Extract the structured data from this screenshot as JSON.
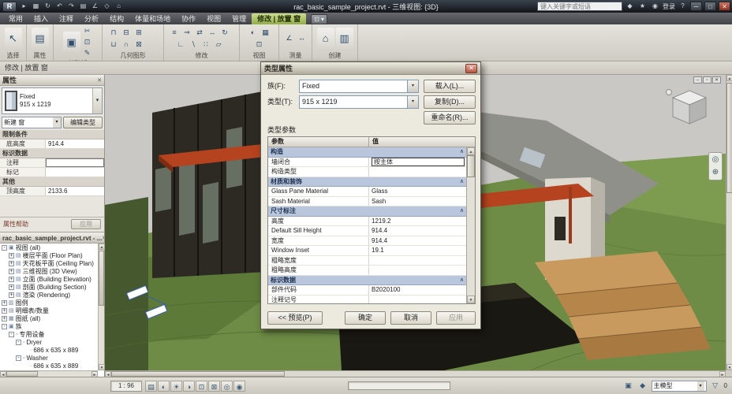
{
  "ui": {
    "caret": "▾",
    "scroll_up": "▲",
    "scroll_down": "▼",
    "scroll_left": "◄",
    "scroll_right": "►",
    "close": "✕",
    "minimize": "─",
    "maximize": "□"
  },
  "titlebar": {
    "app_button": "R",
    "qat": [
      {
        "name": "open-icon",
        "glyph": "▸"
      },
      {
        "name": "save-icon",
        "glyph": "▦"
      },
      {
        "name": "sync-icon",
        "glyph": "↻"
      },
      {
        "name": "undo-icon",
        "glyph": "↶"
      },
      {
        "name": "redo-icon",
        "glyph": "↷"
      },
      {
        "name": "print-icon",
        "glyph": "▤"
      },
      {
        "name": "measure-icon",
        "glyph": "∠"
      },
      {
        "name": "tag-icon",
        "glyph": "◇"
      },
      {
        "name": "default-3d-icon",
        "glyph": "⌂"
      }
    ],
    "title": "rac_basic_sample_project.rvt - 三维视图: {3D}",
    "search_placeholder": "键入关键字或短语",
    "right_icons": [
      {
        "name": "communication-center-icon",
        "glyph": "◆"
      },
      {
        "name": "favorites-icon",
        "glyph": "★"
      },
      {
        "name": "user-icon",
        "glyph": "◉"
      }
    ],
    "signin_label": "登录",
    "help_glyph": "?"
  },
  "tabs": [
    {
      "label": "常用"
    },
    {
      "label": "插入"
    },
    {
      "label": "注释"
    },
    {
      "label": "分析"
    },
    {
      "label": "结构"
    },
    {
      "label": "体量和场地"
    },
    {
      "label": "协作"
    },
    {
      "label": "视图"
    },
    {
      "label": "管理"
    },
    {
      "label": "修改 | 放置 窗",
      "active": true
    }
  ],
  "tab_extra": {
    "glyph": "⊡"
  },
  "ribbon": {
    "panels": [
      {
        "label": "选择",
        "tools": [
          {
            "name": "modify-select-tool",
            "glyph": "↖"
          }
        ]
      },
      {
        "label": "属性",
        "tools": [
          {
            "name": "properties-tool",
            "glyph": "▤"
          }
        ]
      },
      {
        "label": "剪贴板",
        "tools": [
          {
            "name": "paste-tool",
            "glyph": "▣"
          },
          {
            "name": "cut-tool",
            "glyph": "✂"
          },
          {
            "name": "copy-tool",
            "glyph": "⊡"
          },
          {
            "name": "match-type-tool",
            "glyph": "✎"
          }
        ]
      },
      {
        "label": "几何图形",
        "tools": [
          {
            "name": "cope-tool",
            "glyph": "⊓"
          },
          {
            "name": "cut-geometry-tool",
            "glyph": "⊟"
          },
          {
            "name": "join-tool",
            "glyph": "⊞"
          },
          {
            "name": "wall-joins-tool",
            "glyph": "⊔"
          },
          {
            "name": "beam-join-tool",
            "glyph": "∩"
          },
          {
            "name": "unjoin-tool",
            "glyph": "⊠"
          }
        ]
      },
      {
        "label": "修改",
        "tools": [
          {
            "name": "align-tool",
            "glyph": "≡"
          },
          {
            "name": "offset-tool",
            "glyph": "⇒"
          },
          {
            "name": "mirror-tool",
            "glyph": "⇄"
          },
          {
            "name": "move-tool",
            "glyph": "↔"
          },
          {
            "name": "rotate-tool",
            "glyph": "↻"
          },
          {
            "name": "trim-tool",
            "glyph": "∟"
          },
          {
            "name": "split-tool",
            "glyph": "∖"
          },
          {
            "name": "array-tool",
            "glyph": "∷"
          },
          {
            "name": "scale-tool",
            "glyph": "▱"
          }
        ]
      },
      {
        "label": "视图",
        "tools": [
          {
            "name": "thin-lines-tool",
            "glyph": "◐"
          },
          {
            "name": "hide-isolate-tool",
            "glyph": "▦"
          },
          {
            "name": "windows-tool",
            "glyph": "⊡"
          }
        ]
      },
      {
        "label": "测量",
        "tools": [
          {
            "name": "measure-tool",
            "glyph": "∠"
          },
          {
            "name": "dimension-tool",
            "glyph": "↔"
          }
        ]
      },
      {
        "label": "创建",
        "tools": [
          {
            "name": "create-group-tool",
            "glyph": "⌂"
          },
          {
            "name": "load-family-tool",
            "glyph": "▥"
          }
        ]
      }
    ]
  },
  "options_bar": {
    "label": "修改 | 放置 窗"
  },
  "properties": {
    "title": "属性",
    "type_name": "Fixed",
    "type_size": "915 x 1219",
    "selector_label": "新建 窗",
    "edit_type_label": "编辑类型",
    "rows": [
      {
        "kind": "group",
        "label": "限制条件"
      },
      {
        "kind": "param",
        "name": "底高度",
        "value": "914.4"
      },
      {
        "kind": "group",
        "label": "标识数据"
      },
      {
        "kind": "param",
        "name": "注释",
        "value": ""
      },
      {
        "kind": "param",
        "name": "标记",
        "value": ""
      },
      {
        "kind": "group",
        "label": "其他"
      },
      {
        "kind": "param",
        "name": "顶高度",
        "value": "2133.6"
      }
    ],
    "help_label": "属性帮助",
    "apply_label": "应用"
  },
  "browser": {
    "title": "rac_basic_sample_project.rvt - ...",
    "items": [
      {
        "indent": 0,
        "expander": "-",
        "icon": "▣",
        "label": "视图 (all)"
      },
      {
        "indent": 1,
        "expander": "+",
        "icon": "▤",
        "label": "楼层平面 (Floor Plan)"
      },
      {
        "indent": 1,
        "expander": "+",
        "icon": "▤",
        "label": "天花板平面 (Ceiling Plan)"
      },
      {
        "indent": 1,
        "expander": "+",
        "icon": "▤",
        "label": "三维视图 (3D View)"
      },
      {
        "indent": 1,
        "expander": "+",
        "icon": "▤",
        "label": "立面 (Building Elevation)"
      },
      {
        "indent": 1,
        "expander": "+",
        "icon": "▤",
        "label": "剖面 (Building Section)"
      },
      {
        "indent": 1,
        "expander": "+",
        "icon": "▤",
        "label": "渲染 (Rendering)"
      },
      {
        "indent": 0,
        "expander": "+",
        "icon": "▥",
        "label": "图例"
      },
      {
        "indent": 0,
        "expander": "+",
        "icon": "▤",
        "label": "明细表/数量"
      },
      {
        "indent": 0,
        "expander": "+",
        "icon": "▦",
        "label": "图纸 (all)"
      },
      {
        "indent": 0,
        "expander": "-",
        "icon": "▣",
        "label": "族"
      },
      {
        "indent": 1,
        "expander": "-",
        "icon": "▫",
        "label": "专用设备"
      },
      {
        "indent": 2,
        "expander": "-",
        "icon": "▫",
        "label": "Dryer"
      },
      {
        "indent": 3,
        "expander": "",
        "icon": "·",
        "label": "686 x 635 x 889"
      },
      {
        "indent": 2,
        "expander": "-",
        "icon": "▫",
        "label": "Washer"
      },
      {
        "indent": 3,
        "expander": "",
        "icon": "·",
        "label": "686 x 635 x 889"
      }
    ]
  },
  "viewport": {
    "window_controls": [
      {
        "name": "view-minimize-icon",
        "glyph": "─"
      },
      {
        "name": "view-restore-icon",
        "glyph": "▫"
      },
      {
        "name": "view-close-icon",
        "glyph": "✕"
      }
    ],
    "navbar": [
      {
        "name": "steering-wheel-icon",
        "glyph": "◎"
      },
      {
        "name": "zoom-icon",
        "glyph": "⊕"
      }
    ]
  },
  "view_controls": {
    "scale": "1 : 96",
    "icons": [
      {
        "name": "detail-level-icon",
        "glyph": "▤"
      },
      {
        "name": "visual-style-icon",
        "glyph": "◐"
      },
      {
        "name": "sun-path-icon",
        "glyph": "☀"
      },
      {
        "name": "shadows-icon",
        "glyph": "◑"
      },
      {
        "name": "crop-view-icon",
        "glyph": "⊡"
      },
      {
        "name": "show-crop-icon",
        "glyph": "⊠"
      },
      {
        "name": "temporary-hide-icon",
        "glyph": "◎"
      },
      {
        "name": "reveal-hidden-icon",
        "glyph": "◉"
      }
    ]
  },
  "statusbar": {
    "right_icons": [
      {
        "name": "worksharing-icon",
        "glyph": "▣"
      },
      {
        "name": "design-options-icon",
        "glyph": "◆"
      }
    ],
    "workset_label": "主模型",
    "filter_glyph": "▽",
    "selection_count": "0"
  },
  "dialog": {
    "title": "类型属性",
    "family_label": "族(F):",
    "family_value": "Fixed",
    "type_label": "类型(T):",
    "type_value": "915 x 1219",
    "load_button": "载入(L)...",
    "duplicate_button": "复制(D)...",
    "rename_button": "重命名(R)...",
    "type_params_label": "类型参数",
    "col_param": "参数",
    "col_value": "值",
    "group_pin": "∧",
    "rows": [
      {
        "kind": "group",
        "label": "构造"
      },
      {
        "kind": "param",
        "name": "墙闭合",
        "value": "按主体"
      },
      {
        "kind": "param",
        "name": "构造类型",
        "value": ""
      },
      {
        "kind": "group",
        "label": "材质和装饰"
      },
      {
        "kind": "param",
        "name": "Glass Pane Material",
        "value": "Glass"
      },
      {
        "kind": "param",
        "name": "Sash Material",
        "value": "Sash"
      },
      {
        "kind": "group",
        "label": "尺寸标注"
      },
      {
        "kind": "param",
        "name": "高度",
        "value": "1219.2"
      },
      {
        "kind": "param",
        "name": "Default Sill Height",
        "value": "914.4"
      },
      {
        "kind": "param",
        "name": "宽度",
        "value": "914.4"
      },
      {
        "kind": "param",
        "name": "Window Inset",
        "value": "19.1"
      },
      {
        "kind": "param",
        "name": "粗略宽度",
        "value": ""
      },
      {
        "kind": "param",
        "name": "粗略高度",
        "value": ""
      },
      {
        "kind": "group",
        "label": "标识数据"
      },
      {
        "kind": "param",
        "name": "部件代码",
        "value": "B2020100"
      },
      {
        "kind": "param",
        "name": "注释记号",
        "value": ""
      }
    ],
    "preview_button": "<< 预览(P)",
    "ok_button": "确定",
    "cancel_button": "取消",
    "apply_button": "应用"
  }
}
